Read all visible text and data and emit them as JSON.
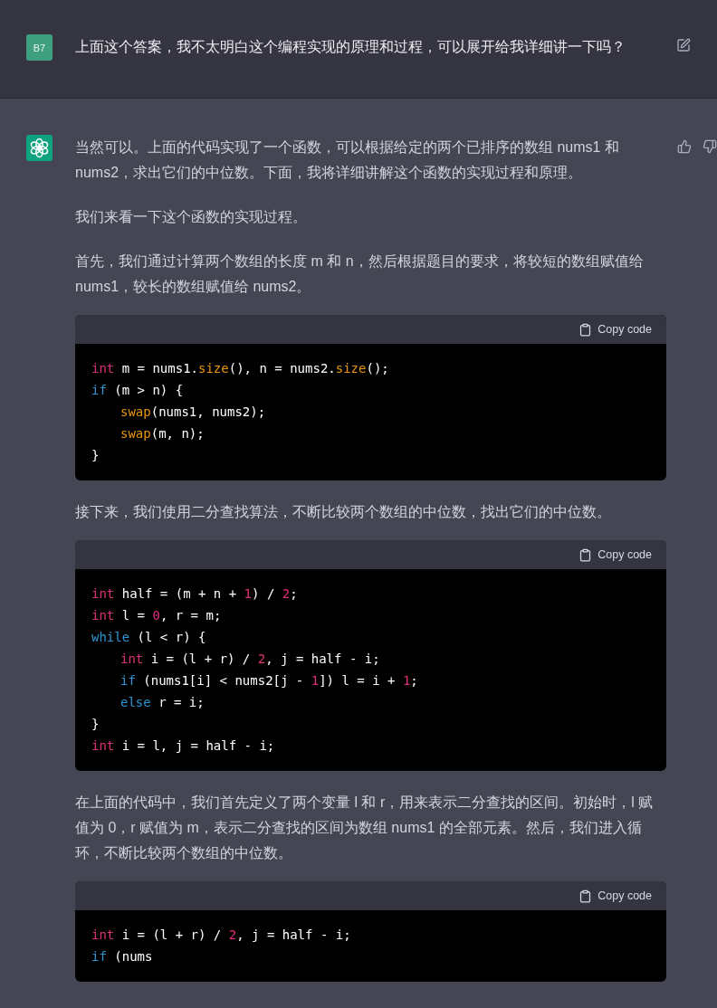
{
  "user_message": {
    "avatar": "B7",
    "text": "上面这个答案，我不太明白这个编程实现的原理和过程，可以展开给我详细讲一下吗？"
  },
  "assistant_message": {
    "blocks": [
      {
        "kind": "text",
        "text": "当然可以。上面的代码实现了一个函数，可以根据给定的两个已排序的数组 nums1 和 nums2，求出它们的中位数。下面，我将详细讲解这个函数的实现过程和原理。"
      },
      {
        "kind": "text",
        "text": "我们来看一下这个函数的实现过程。"
      },
      {
        "kind": "text",
        "text": "首先，我们通过计算两个数组的长度 m 和 n，然后根据题目的要求，将较短的数组赋值给 nums1，较长的数组赋值给 nums2。"
      },
      {
        "kind": "code",
        "copy_label": "Copy code",
        "lines": [
          {
            "indented": false,
            "tokens": [
              {
                "kind": "type",
                "text": "int"
              },
              {
                "kind": "plain",
                "text": " m = nums1."
              },
              {
                "kind": "func",
                "text": "size"
              },
              {
                "kind": "plain",
                "text": "(), n = nums2."
              },
              {
                "kind": "func",
                "text": "size"
              },
              {
                "kind": "plain",
                "text": "();"
              }
            ]
          },
          {
            "indented": false,
            "tokens": [
              {
                "kind": "keyword",
                "text": "if"
              },
              {
                "kind": "plain",
                "text": " (m > n) {"
              }
            ]
          },
          {
            "indented": true,
            "tokens": [
              {
                "kind": "func",
                "text": "swap"
              },
              {
                "kind": "plain",
                "text": "(nums1, nums2);"
              }
            ]
          },
          {
            "indented": true,
            "tokens": [
              {
                "kind": "func",
                "text": "swap"
              },
              {
                "kind": "plain",
                "text": "(m, n);"
              }
            ]
          },
          {
            "indented": false,
            "tokens": [
              {
                "kind": "plain",
                "text": "}"
              }
            ]
          }
        ]
      },
      {
        "kind": "text",
        "text": "接下来，我们使用二分查找算法，不断比较两个数组的中位数，找出它们的中位数。"
      },
      {
        "kind": "code",
        "copy_label": "Copy code",
        "lines": [
          {
            "indented": false,
            "tokens": [
              {
                "kind": "type",
                "text": "int"
              },
              {
                "kind": "plain",
                "text": " half = (m + n + "
              },
              {
                "kind": "number",
                "text": "1"
              },
              {
                "kind": "plain",
                "text": ") / "
              },
              {
                "kind": "number",
                "text": "2"
              },
              {
                "kind": "plain",
                "text": ";"
              }
            ]
          },
          {
            "indented": false,
            "tokens": [
              {
                "kind": "type",
                "text": "int"
              },
              {
                "kind": "plain",
                "text": " l = "
              },
              {
                "kind": "number",
                "text": "0"
              },
              {
                "kind": "plain",
                "text": ", r = m;"
              }
            ]
          },
          {
            "indented": false,
            "tokens": [
              {
                "kind": "keyword",
                "text": "while"
              },
              {
                "kind": "plain",
                "text": " (l < r) {"
              }
            ]
          },
          {
            "indented": true,
            "tokens": [
              {
                "kind": "type",
                "text": "int"
              },
              {
                "kind": "plain",
                "text": " i = (l + r) / "
              },
              {
                "kind": "number",
                "text": "2"
              },
              {
                "kind": "plain",
                "text": ", j = half - i;"
              }
            ]
          },
          {
            "indented": true,
            "tokens": [
              {
                "kind": "keyword",
                "text": "if"
              },
              {
                "kind": "plain",
                "text": " (nums1[i] < nums2[j - "
              },
              {
                "kind": "number",
                "text": "1"
              },
              {
                "kind": "plain",
                "text": "]) l = i + "
              },
              {
                "kind": "number",
                "text": "1"
              },
              {
                "kind": "plain",
                "text": ";"
              }
            ]
          },
          {
            "indented": true,
            "tokens": [
              {
                "kind": "keyword",
                "text": "else"
              },
              {
                "kind": "plain",
                "text": " r = i;"
              }
            ]
          },
          {
            "indented": false,
            "tokens": [
              {
                "kind": "plain",
                "text": "}"
              }
            ]
          },
          {
            "indented": false,
            "tokens": [
              {
                "kind": "type",
                "text": "int"
              },
              {
                "kind": "plain",
                "text": " i = l, j = half - i;"
              }
            ]
          }
        ]
      },
      {
        "kind": "text",
        "text": "在上面的代码中，我们首先定义了两个变量 l 和 r，用来表示二分查找的区间。初始时，l 赋值为 0，r 赋值为 m，表示二分查找的区间为数组 nums1 的全部元素。然后，我们进入循环，不断比较两个数组的中位数。"
      },
      {
        "kind": "code",
        "copy_label": "Copy code",
        "lines": [
          {
            "indented": false,
            "tokens": [
              {
                "kind": "type",
                "text": "int"
              },
              {
                "kind": "plain",
                "text": " i = (l + r) / "
              },
              {
                "kind": "number",
                "text": "2"
              },
              {
                "kind": "plain",
                "text": ", j = half - i;"
              }
            ]
          },
          {
            "indented": false,
            "tokens": [
              {
                "kind": "keyword",
                "text": "if"
              },
              {
                "kind": "plain",
                "text": " (nums"
              }
            ]
          }
        ]
      }
    ]
  }
}
